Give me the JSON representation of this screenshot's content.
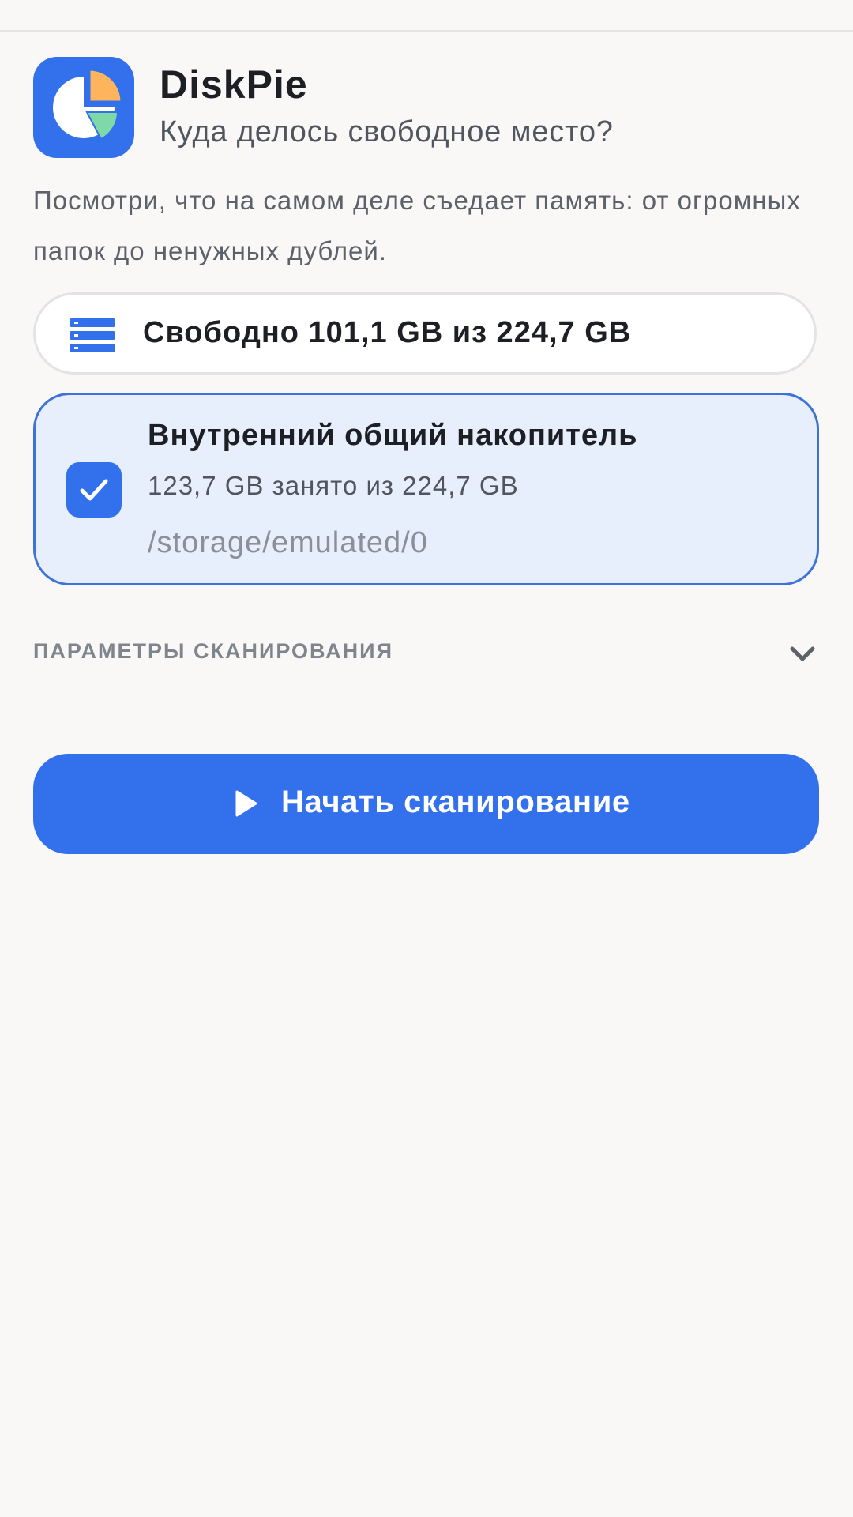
{
  "app": {
    "name": "DiskPie",
    "tagline": "Куда делось свободное место?",
    "description": "Посмотри, что на самом деле съедает память: от огромных папок до ненужных дублей."
  },
  "free_space": {
    "text": "Свободно 101,1 GB из 224,7 GB",
    "icon": "storage-stack-icon"
  },
  "volume": {
    "selected": true,
    "title": "Внутренний общий накопитель",
    "usage": "123,7 GB занято из 224,7 GB",
    "path": "/storage/emulated/0"
  },
  "scan_settings": {
    "title": "ПАРАМЕТРЫ СКАНИРОВАНИЯ",
    "expanded": false,
    "icon": "chevron-down-icon"
  },
  "actions": {
    "scan_label": "Начать сканирование",
    "scan_icon": "play-icon"
  },
  "colors": {
    "accent": "#3370EB",
    "background": "#F9F8F7",
    "card_selected_bg": "#E8EFFC",
    "pie_orange": "#FDB45C",
    "pie_green": "#7FD8A8"
  }
}
